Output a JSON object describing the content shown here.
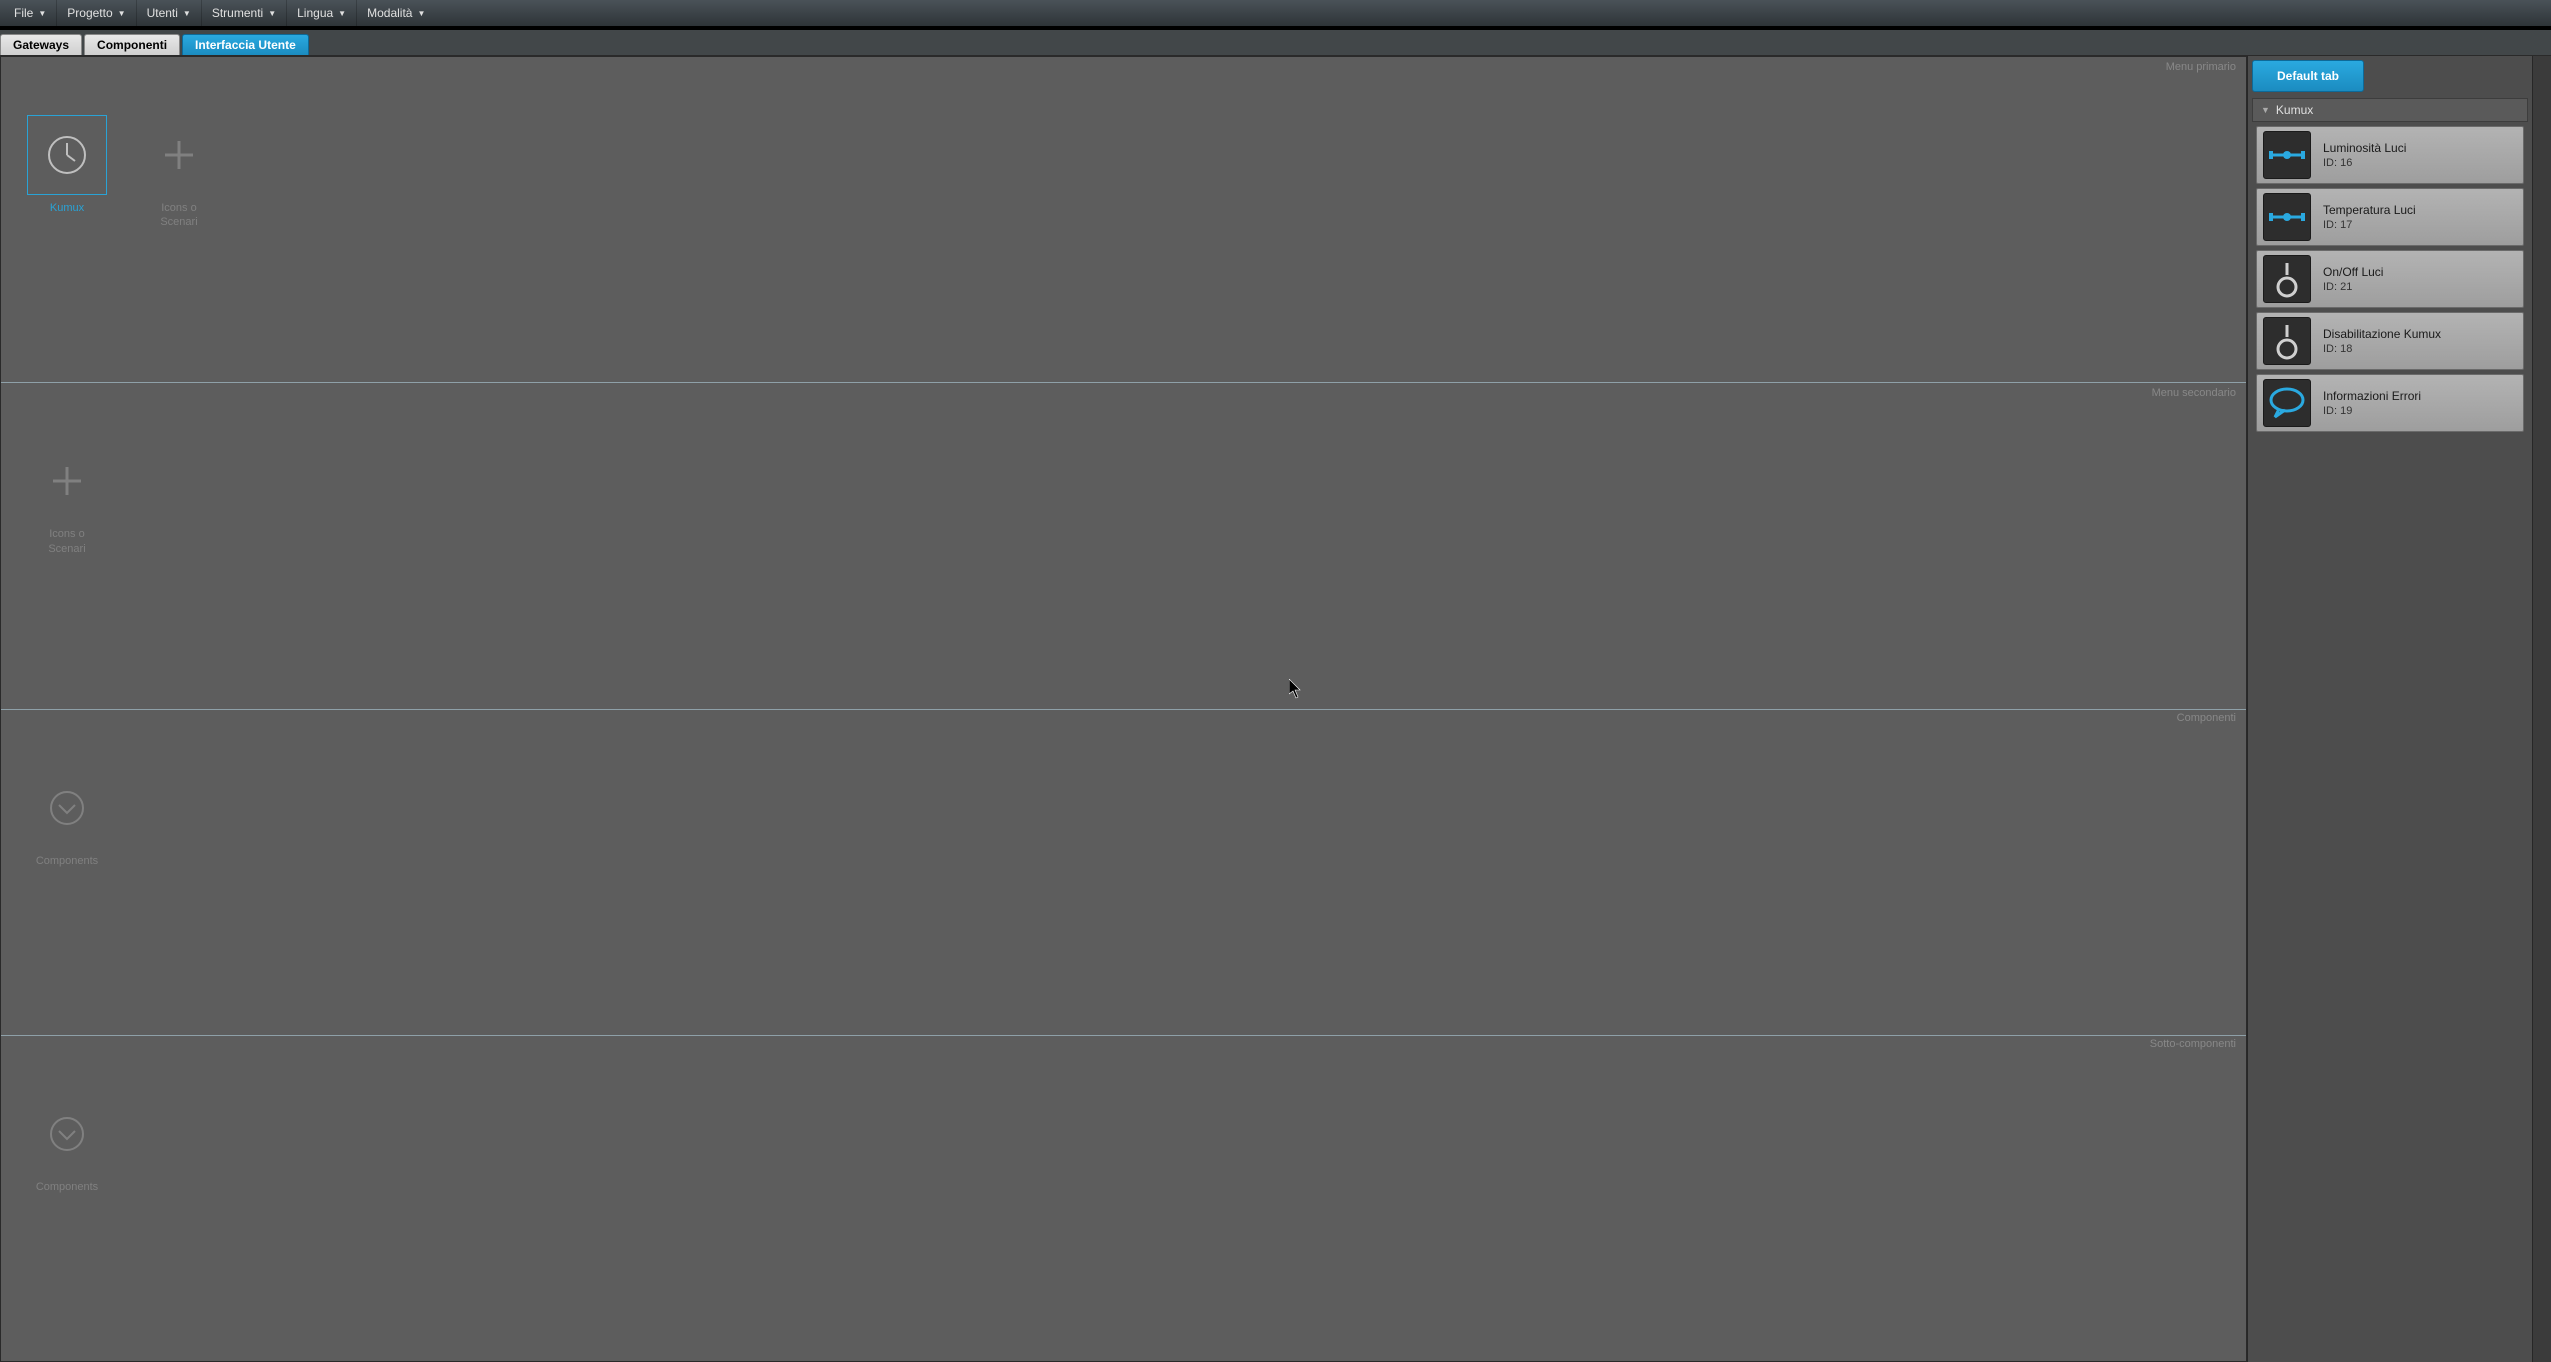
{
  "menubar": {
    "items": [
      "File",
      "Progetto",
      "Utenti",
      "Strumenti",
      "Lingua",
      "Modalità"
    ]
  },
  "tabs": {
    "items": [
      {
        "label": "Gateways",
        "active": false
      },
      {
        "label": "Componenti",
        "active": false
      },
      {
        "label": "Interfaccia Utente",
        "active": true
      }
    ]
  },
  "canvas": {
    "rows": [
      {
        "label": "Menu primario",
        "tiles": [
          {
            "kind": "clock",
            "label": "Kumux",
            "selected": true
          },
          {
            "kind": "add",
            "label": "Icons o\nScenari",
            "selected": false
          }
        ]
      },
      {
        "label": "Menu secondario",
        "tiles": [
          {
            "kind": "add",
            "label": "Icons o\nScenari",
            "selected": false
          }
        ]
      },
      {
        "label": "Componenti",
        "tiles": [
          {
            "kind": "chevron",
            "label": "Components",
            "selected": false
          }
        ]
      },
      {
        "label": "Sotto-componenti",
        "tiles": [
          {
            "kind": "chevron",
            "label": "Components",
            "selected": false
          }
        ]
      }
    ]
  },
  "rightpanel": {
    "default_tab_label": "Default tab",
    "section_title": "Kumux",
    "id_prefix": "ID:",
    "items": [
      {
        "icon": "slider",
        "name": "Luminosità Luci",
        "id": "16"
      },
      {
        "icon": "slider",
        "name": "Temperatura Luci",
        "id": "17"
      },
      {
        "icon": "switch",
        "name": "On/Off Luci",
        "id": "21"
      },
      {
        "icon": "switch",
        "name": "Disabilitazione Kumux",
        "id": "18"
      },
      {
        "icon": "chat",
        "name": "Informazioni Errori",
        "id": "19"
      }
    ]
  }
}
